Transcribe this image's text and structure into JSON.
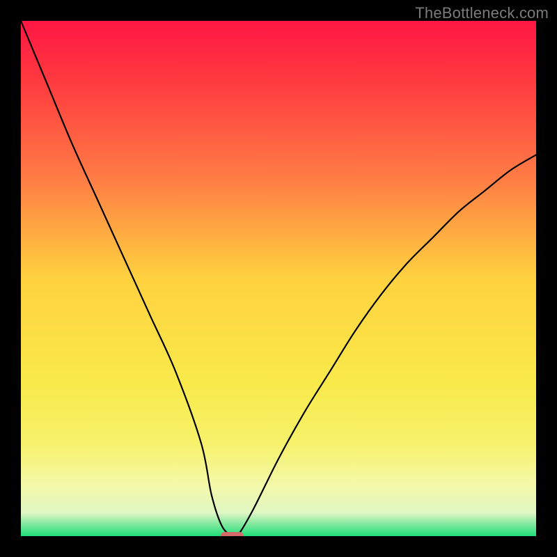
{
  "attribution": "TheBottleneck.com",
  "chart_data": {
    "type": "line",
    "title": "",
    "xlabel": "",
    "ylabel": "",
    "xlim": [
      0,
      100
    ],
    "ylim": [
      0,
      100
    ],
    "grid": false,
    "legend": false,
    "series": [
      {
        "name": "bottleneck-curve",
        "x": [
          0,
          5,
          10,
          15,
          20,
          25,
          30,
          35,
          37,
          39,
          41,
          42,
          45,
          50,
          55,
          60,
          65,
          70,
          75,
          80,
          85,
          90,
          95,
          100
        ],
        "values": [
          100,
          88,
          76,
          65,
          54,
          43,
          32,
          18,
          8,
          2,
          0,
          0,
          5,
          15,
          24,
          32,
          40,
          47,
          53,
          58,
          63,
          67,
          71,
          74
        ]
      }
    ],
    "marker": {
      "name": "highlight-marker",
      "x": 41,
      "y": 0,
      "width": 4.5,
      "height": 1.6,
      "color": "#d46a6a"
    },
    "background_gradient": {
      "stops": [
        {
          "offset": 0.0,
          "color": "#ff1744"
        },
        {
          "offset": 0.12,
          "color": "#ff3b3f"
        },
        {
          "offset": 0.3,
          "color": "#ff7a45"
        },
        {
          "offset": 0.5,
          "color": "#ffd23f"
        },
        {
          "offset": 0.7,
          "color": "#f9e94a"
        },
        {
          "offset": 0.82,
          "color": "#f6f26b"
        },
        {
          "offset": 0.9,
          "color": "#f4f8a8"
        },
        {
          "offset": 0.955,
          "color": "#dff7c4"
        },
        {
          "offset": 0.975,
          "color": "#88e9a0"
        },
        {
          "offset": 1.0,
          "color": "#1fe07a"
        }
      ]
    }
  }
}
